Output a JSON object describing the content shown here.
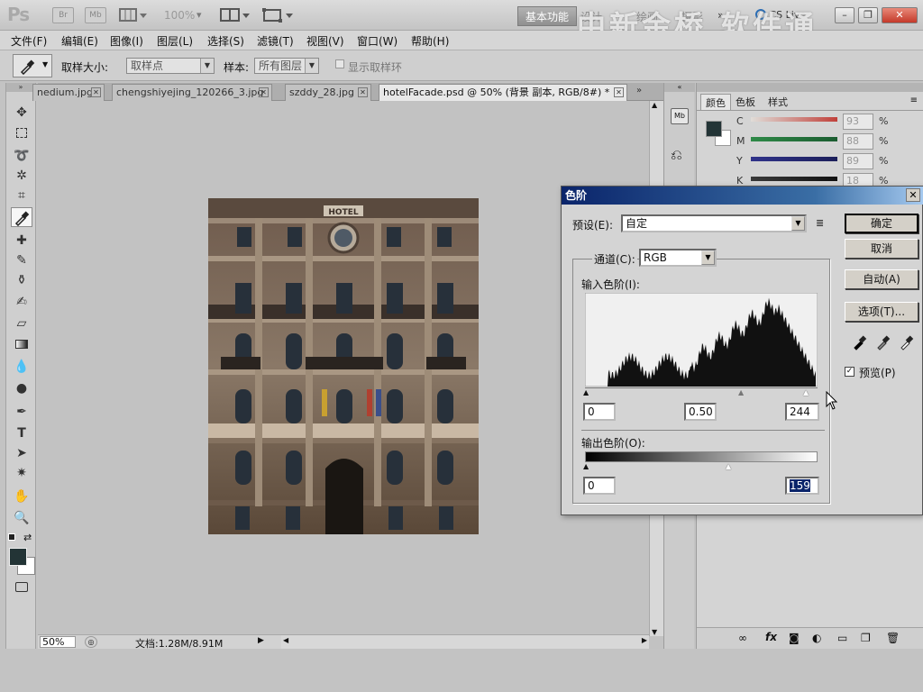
{
  "appbar": {
    "logo": "Ps",
    "icons": [
      "Br",
      "Mb"
    ],
    "zoom_value": "100%",
    "workspace_active": "基本功能",
    "workspace_items": [
      "设计",
      "绘画",
      "摄影"
    ],
    "more": "»",
    "cs_live": "CS Live",
    "watermark": "中新金桥 软件通",
    "minimize": "–",
    "restore": "❐",
    "close": "✕"
  },
  "menu": [
    "文件(F)",
    "编辑(E)",
    "图像(I)",
    "图层(L)",
    "选择(S)",
    "滤镜(T)",
    "视图(V)",
    "窗口(W)",
    "帮助(H)"
  ],
  "options": {
    "sample_size_label": "取样大小:",
    "sample_size_value": "取样点",
    "sample_label": "样本:",
    "sample_value": "所有图层",
    "show_ring_label": "显示取样环"
  },
  "tabs": [
    {
      "label": "nedium.jpg"
    },
    {
      "label": "chengshiyejing_120266_3.jpg"
    },
    {
      "label": "szddy_28.jpg"
    },
    {
      "label": "hotelFacade.psd @ 50% (背景 副本, RGB/8#) *"
    }
  ],
  "status": {
    "zoom": "50%",
    "doc_info": "文档:1.28M/8.91M"
  },
  "color_panel": {
    "tabs": [
      "颜色",
      "色板",
      "样式"
    ],
    "sliders": [
      {
        "label": "C",
        "value": "93",
        "pct": "%",
        "color": "#c0403a"
      },
      {
        "label": "M",
        "value": "88",
        "pct": "%",
        "color": "#2f8a48"
      },
      {
        "label": "Y",
        "value": "89",
        "pct": "%",
        "color": "#30338a"
      },
      {
        "label": "K",
        "value": "18",
        "pct": "%",
        "color": "#1a1a1a"
      }
    ],
    "strip_labels": [
      "Mb"
    ]
  },
  "levels": {
    "title": "色阶",
    "close": "✕",
    "preset_label": "预设(E):",
    "preset_value": "自定",
    "channel_label": "通道(C):",
    "channel_value": "RGB",
    "input_label": "输入色阶(I):",
    "input_black": "0",
    "input_gamma": "0.50",
    "input_white": "244",
    "output_label": "输出色阶(O):",
    "output_black": "0",
    "output_white": "159",
    "buttons": {
      "ok": "确定",
      "cancel": "取消",
      "auto": "自动(A)",
      "options": "选项(T)..."
    },
    "preview_label": "预览(P)",
    "preview_checked": true
  },
  "photo": {
    "sign": "HOTEL"
  }
}
